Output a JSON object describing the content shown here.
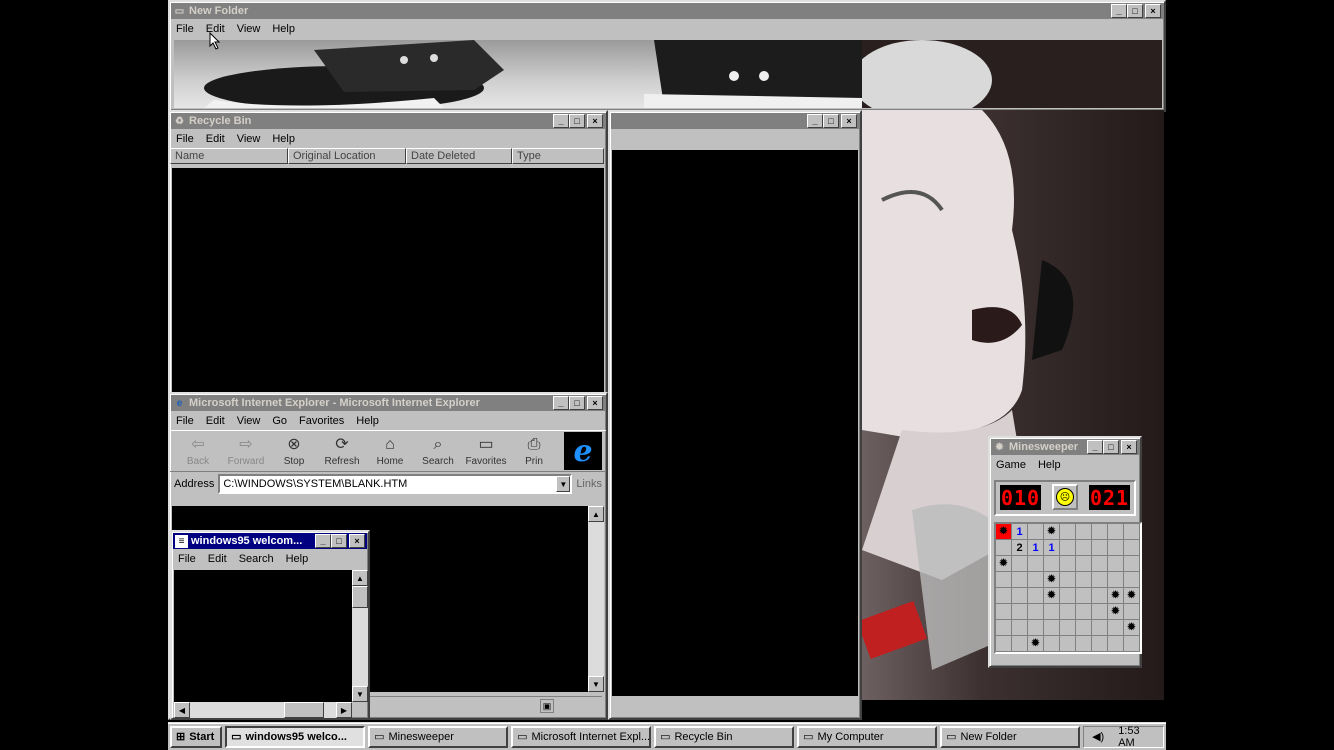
{
  "new_folder_window": {
    "title": "New Folder",
    "menu": [
      "File",
      "Edit",
      "View",
      "Help"
    ]
  },
  "recycle_bin_window": {
    "title": "Recycle Bin",
    "menu": [
      "File",
      "Edit",
      "View",
      "Help"
    ],
    "columns": [
      "Name",
      "Original Location",
      "Date Deleted",
      "Type"
    ]
  },
  "ie_window": {
    "title": "Microsoft Internet Explorer - Microsoft Internet Explorer",
    "menu": [
      "File",
      "Edit",
      "View",
      "Go",
      "Favorites",
      "Help"
    ],
    "toolbar": [
      {
        "label": "Back",
        "icon": "back-arrow-icon",
        "glyph": "⇦",
        "disabled": true
      },
      {
        "label": "Forward",
        "icon": "forward-arrow-icon",
        "glyph": "⇨",
        "disabled": true
      },
      {
        "label": "Stop",
        "icon": "stop-icon",
        "glyph": "⊗",
        "disabled": false
      },
      {
        "label": "Refresh",
        "icon": "refresh-icon",
        "glyph": "⟳",
        "disabled": false
      },
      {
        "label": "Home",
        "icon": "home-icon",
        "glyph": "⌂",
        "disabled": false
      },
      {
        "label": "Search",
        "icon": "search-icon",
        "glyph": "⌕",
        "disabled": false
      },
      {
        "label": "Favorites",
        "icon": "favorites-folder-icon",
        "glyph": "▭",
        "disabled": false
      },
      {
        "label": "Prin",
        "icon": "print-icon",
        "glyph": "⎙",
        "disabled": false
      }
    ],
    "address_label": "Address",
    "address_value": "C:\\WINDOWS\\SYSTEM\\BLANK.HTM",
    "links_label": "Links"
  },
  "notepad_window": {
    "title": "windows95 welcom...",
    "menu": [
      "File",
      "Edit",
      "Search",
      "Help"
    ]
  },
  "minesweeper_window": {
    "title": "Minesweeper",
    "menu": [
      "Game",
      "Help"
    ],
    "mine_counter": "010",
    "timer": "021",
    "grid": [
      [
        "X",
        "1",
        "",
        "M",
        "",
        "",
        "",
        "",
        ""
      ],
      [
        "",
        "2",
        "1",
        "1",
        "",
        "",
        "",
        "",
        ""
      ],
      [
        "M",
        "",
        "",
        "",
        "",
        "",
        "",
        "",
        ""
      ],
      [
        "",
        "",
        "",
        "M",
        "",
        "",
        "",
        "",
        ""
      ],
      [
        "",
        "",
        "",
        "M",
        "",
        "",
        "",
        "M",
        "M"
      ],
      [
        "",
        "",
        "",
        "",
        "",
        "",
        "",
        "M",
        ""
      ],
      [
        "",
        "",
        "",
        "",
        "",
        "",
        "",
        "",
        "M"
      ],
      [
        "",
        "",
        "M",
        "",
        "",
        "",
        "",
        "",
        ""
      ]
    ],
    "colors": {
      "one": "#0000ff",
      "two": "#000000",
      "hit": "#ff0000"
    }
  },
  "taskbar": {
    "start_label": "Start",
    "buttons": [
      {
        "label": "windows95 welco...",
        "icon": "notepad-icon",
        "pressed": true
      },
      {
        "label": "Minesweeper",
        "icon": "minesweeper-icon",
        "pressed": false
      },
      {
        "label": "Microsoft Internet Expl...",
        "icon": "ie-icon",
        "pressed": false
      },
      {
        "label": "Recycle Bin",
        "icon": "recycle-bin-icon",
        "pressed": false
      },
      {
        "label": "My Computer",
        "icon": "computer-icon",
        "pressed": false
      },
      {
        "label": "New Folder",
        "icon": "folder-icon",
        "pressed": false
      }
    ],
    "clock": "1:53 AM"
  },
  "colors": {
    "active_title": "#000080",
    "inactive_title": "#808080",
    "face": "#c0c0c0"
  }
}
